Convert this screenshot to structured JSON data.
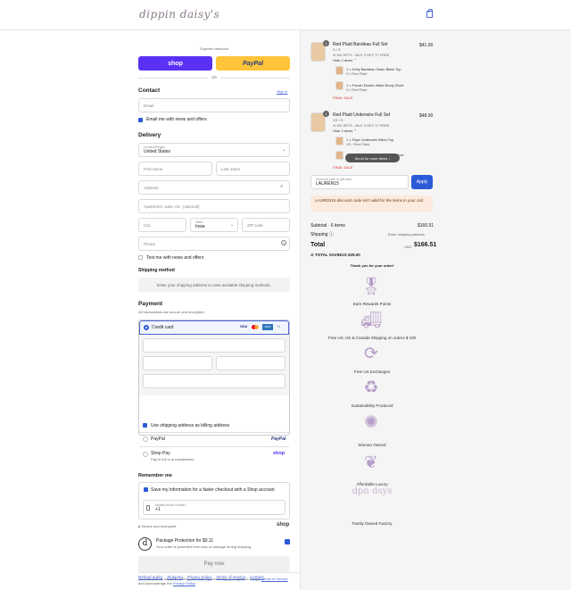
{
  "header": {
    "logo": "dippin daisy's",
    "cart_icon": "bag-icon"
  },
  "express": {
    "label": "Express checkout",
    "shop_label": "shop",
    "paypal_label": "PayPal",
    "or": "OR"
  },
  "contact": {
    "title": "Contact",
    "signin": "Sign in",
    "email_placeholder": "Email",
    "news_label": "Email me with news and offers"
  },
  "delivery": {
    "title": "Delivery",
    "country_label": "Country/Region",
    "country_value": "United States",
    "first_name": "First name",
    "last_name": "Last name",
    "address": "Address",
    "apartment": "Apartment, suite, etc. (optional)",
    "city": "City",
    "state_label": "State",
    "state_value": "Iowa",
    "zip": "ZIP code",
    "phone": "Phone",
    "text_news": "Text me with news and offers"
  },
  "shipping_method": {
    "title": "Shipping method",
    "note": "Enter your shipping address to view available shipping methods."
  },
  "payment": {
    "title": "Payment",
    "subtitle": "All transactions are secure and encrypted.",
    "credit_card": "Credit card",
    "card_brands": [
      "VISA",
      "MC",
      "AMEX",
      "+1"
    ],
    "billing_same": "Use shipping address as billing address",
    "paypal": "PayPal",
    "paypal_logo": "PayPal",
    "shoppay": "Shop Pay",
    "shoppay_sub": "Pay in full or in installments",
    "shoppay_logo": "shop"
  },
  "remember": {
    "title": "Remember me",
    "save_label": "Save my information for a faster checkout with a Shop account",
    "phone_label": "Mobile phone number",
    "phone_value": "+1",
    "secure": "Secure and encrypted",
    "shop_logo": "shop"
  },
  "protection": {
    "title": "Package Protection for $0.11",
    "desc": "Your order is protected from loss or damage during shipping."
  },
  "pay_now": "Pay now",
  "legal": {
    "text": "Your info will be saved to a Shop account. By continuing, you agree to Shop's",
    "terms": "Terms of Service",
    "and": "and acknowledge the",
    "privacy": "Privacy Policy"
  },
  "footer_links": [
    "Refund policy",
    "Shipping",
    "Privacy policy",
    "Terms of service",
    "Contact"
  ],
  "cart": {
    "items": [
      {
        "qty": "1",
        "name": "Red Plaid Bandeau Full Set",
        "variant": "S / S",
        "discount": "DD SETS - BUY 3 GET 17 FREE",
        "price": "$41.00",
        "hide": "Hide 2 items",
        "subs": [
          {
            "name": "1 × Kelly Bandeau Swim Bikini Top",
            "variant": "S / Red Plaid"
          },
          {
            "name": "1 × Farrah Elastic Waist Booty Short",
            "variant": "S / Red Plaid"
          }
        ],
        "final": "FINAL SALE"
      },
      {
        "qty": "1",
        "name": "Red Plaid Underwire Full Set",
        "variant": "XS / S",
        "discount": "DD SETS - BUY 3 GET 17 FREE",
        "price": "$48.00",
        "hide": "Hide 2 items",
        "subs": [
          {
            "name": "1 × Faye Underwire Bikini Top",
            "variant": "XS / Red Plaid"
          },
          {
            "name": "1 × Farrah Elastic Waist Booty Short",
            "variant": "S / Red Plaid"
          }
        ],
        "final": "FINAL SALE"
      }
    ],
    "scroll_hint": "Scroll for more items"
  },
  "discount": {
    "label": "Discount code or gift card",
    "value": "LAUREN15",
    "apply": "Apply",
    "error": "LAUREN15 discount code isn't valid for the items in your cart"
  },
  "totals": {
    "subtotal_label": "Subtotal · 6 items",
    "subtotal": "$166.51",
    "shipping_label": "Shipping",
    "shipping": "Enter shipping address",
    "total_label": "Total",
    "currency": "USD",
    "total": "$166.51",
    "savings": "TOTAL SAVINGS $29.00"
  },
  "thanks": "Thank you for your order!",
  "perks": [
    {
      "icon": "ribbon-icon",
      "label": "Earn Rewards Points"
    },
    {
      "icon": "truck-icon",
      "label": "Free US, UK & Canada Shipping on orders $ 100"
    },
    {
      "icon": "exchange-icon",
      "label": "Free US Exchanges"
    },
    {
      "icon": "recycle-icon",
      "label": "Sustainability Produced"
    },
    {
      "icon": "daisy-icon",
      "label": "Woman Owned"
    },
    {
      "icon": "bikini-icon",
      "label": "Affordable Luxury"
    },
    {
      "icon": "dpn-logo-icon",
      "label": "Family Owned Factory",
      "logo_text": "dpn dsys"
    }
  ],
  "colors": {
    "accent": "#4a66d6",
    "shop": "#5a31f4",
    "paypal": "#ffc439",
    "perk": "#b79fc9"
  }
}
